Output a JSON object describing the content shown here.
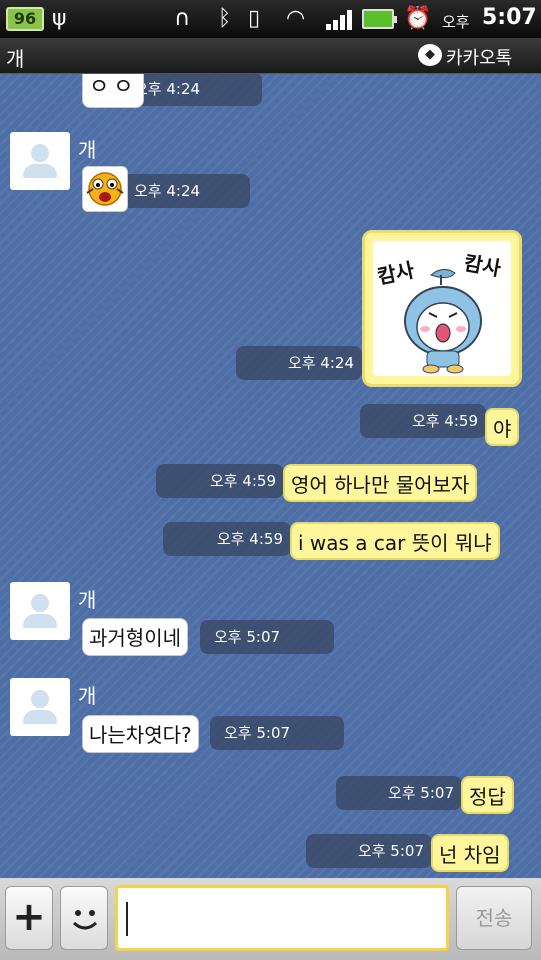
{
  "status_bar": {
    "battery_percent": "96",
    "ampm": "오후",
    "time": "5:07"
  },
  "header": {
    "title": "개",
    "app_label": "카카오톡",
    "app_logo_text": "TALK"
  },
  "messages": [
    {
      "side": "left",
      "kind": "emoticon",
      "text": "ㅇㅇ",
      "time": "오후 4:24"
    },
    {
      "side": "left",
      "kind": "emoticon",
      "sender": "개",
      "time": "오후 4:24"
    },
    {
      "side": "right",
      "kind": "sticker",
      "sticker_text": "캄사 캄사",
      "time": "오후 4:24"
    },
    {
      "side": "right",
      "kind": "text",
      "text": "야",
      "time": "오후 4:59"
    },
    {
      "side": "right",
      "kind": "text",
      "text": "영어 하나만 물어보자",
      "time": "오후 4:59"
    },
    {
      "side": "right",
      "kind": "text",
      "text": "i was a car 뜻이 뭐냐",
      "time": "오후 4:59"
    },
    {
      "side": "left",
      "kind": "text",
      "sender": "개",
      "text": "과거형이네",
      "time": "오후 5:07"
    },
    {
      "side": "left",
      "kind": "text",
      "sender": "개",
      "text": "나는차엿다?",
      "time": "오후 5:07"
    },
    {
      "side": "right",
      "kind": "text",
      "text": "정답",
      "time": "오후 5:07"
    },
    {
      "side": "right",
      "kind": "text",
      "text": "넌 차임",
      "time": "오후 5:07"
    }
  ],
  "input_bar": {
    "plus_label": "+",
    "input_value": "",
    "send_label": "전송"
  },
  "colors": {
    "chat_bg": "#4e6ea6",
    "my_bubble": "#fff59a",
    "their_bubble": "#ffffff",
    "input_border": "#f3d34a"
  }
}
